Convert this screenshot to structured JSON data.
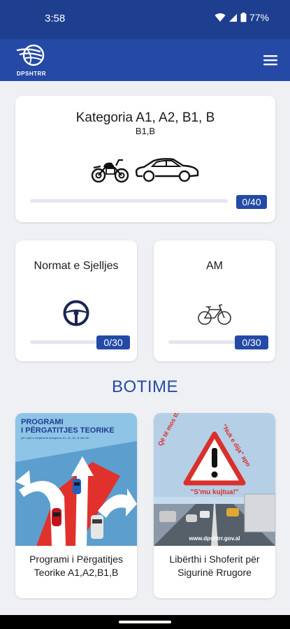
{
  "status_bar": {
    "time": "3:58",
    "battery": "77%"
  },
  "app_bar": {
    "logo_text": "DPSHTRR",
    "menu_icon": "hamburger-menu-icon"
  },
  "main_category": {
    "title": "Kategoria A1, A2, B1, B",
    "subtitle": "B1,B",
    "icons": [
      "motorcycle-icon",
      "car-icon"
    ],
    "progress_label": "0/40",
    "progress": 0
  },
  "small_categories": [
    {
      "title": "Normat e Sjelljes",
      "icon": "steering-wheel-icon",
      "progress_label": "0/30",
      "progress": 0
    },
    {
      "title": "AM",
      "icon": "bicycle-icon",
      "progress_label": "0/30",
      "progress": 0
    }
  ],
  "publications": {
    "section_title": "BOTIME",
    "items": [
      {
        "caption": "Programi i Përgatitjes Teorike A1,A2,B1,B",
        "cover_title_line1": "PROGRAMI",
        "cover_title_line2": "I PËRGATITJES TEORIKE",
        "cover_small_text": "për Lejet e Drejtimit të kategorive A1, A2, B1, B dhe BE"
      },
      {
        "caption": "Libërthi i Shoferit për Sigurinë Rrugore",
        "cover_arc_left": "Që të mos thuash:",
        "cover_quote": "\"Nuk e dija\" apo",
        "cover_quote2": "\"S'mu kujtua!\"",
        "cover_url": "www.dpshtrr.gov.al"
      }
    ]
  },
  "colors": {
    "brand": "#244aa5",
    "status_bar": "#1e3f8f",
    "background": "#eff0f3",
    "accent_red": "#d9302c"
  }
}
